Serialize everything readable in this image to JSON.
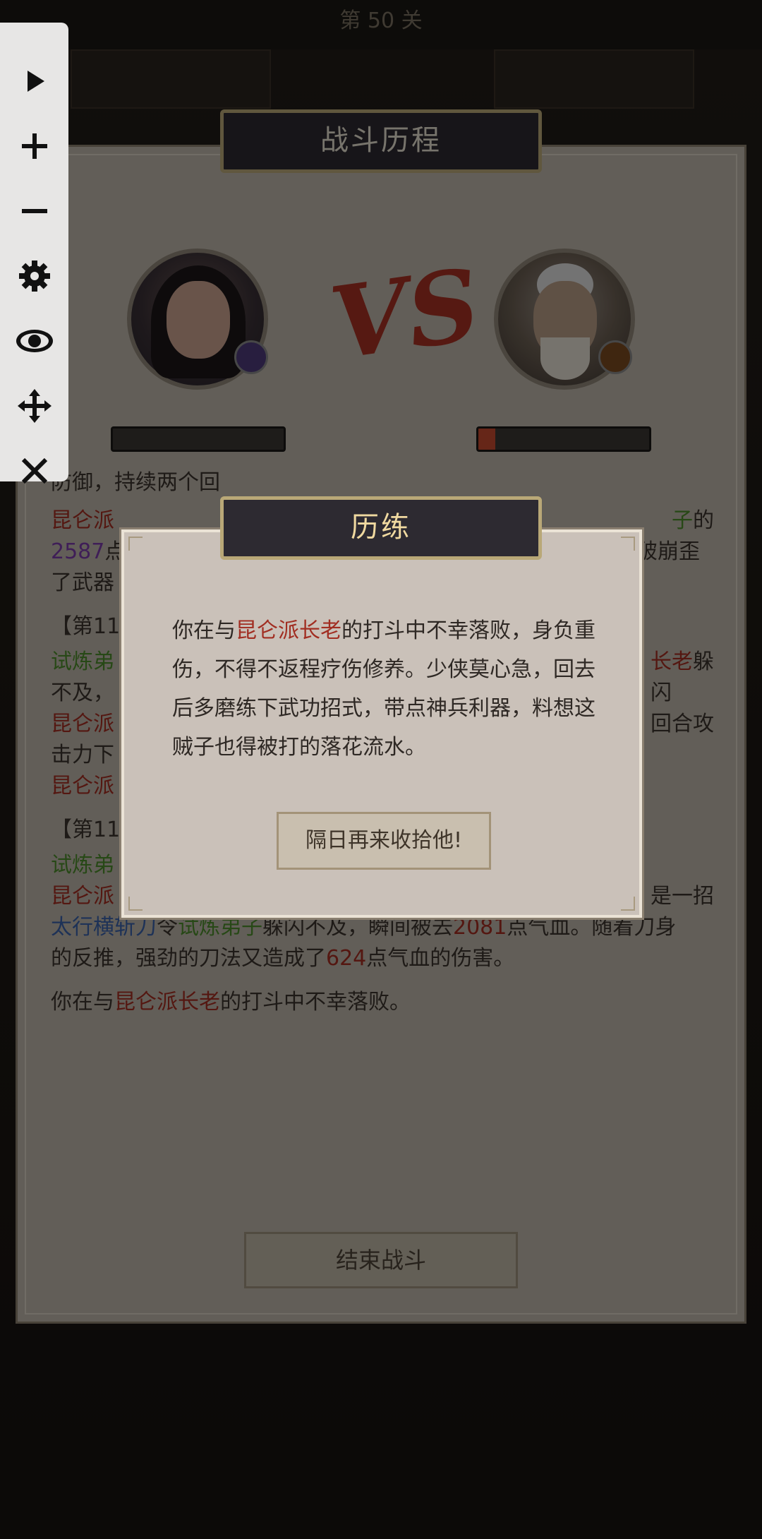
{
  "header": {
    "stage": "第 50 关"
  },
  "battle_panel": {
    "title": "战斗历程"
  },
  "hp_bars": {
    "player_fraction": 0.0,
    "enemy_fraction": 0.1
  },
  "log": {
    "l1_a": "防御，持续两个回",
    "l2_a": "昆仑派",
    "l2_b": "子",
    "l2_c": "的",
    "l3_a": "2587",
    "l3_b": "点",
    "l3_c": "破崩歪",
    "l4_a": "了武器",
    "l5_a": "【第115",
    "l6_a": "试炼弟",
    "l6_b": "长老",
    "l6_c": "躲闪",
    "l7_a": "不及，",
    "l8_a": "昆仑派",
    "l8_b": "回合攻",
    "l9_a": "击力下",
    "l10_a": "昆仑派",
    "l11_a": "【第116",
    "l12_a": "试炼弟",
    "l13_a": "昆仑派",
    "l13_b": "是一招",
    "l14_a": "太行横斩刀",
    "l14_b": "令",
    "l14_c": "试炼弟子",
    "l14_d": "躲闪不及，瞬间被去",
    "l14_e": "2081",
    "l14_f": "点气血。随着刀身",
    "l15_a": "的反推，强劲的刀法又造成了",
    "l15_b": "624",
    "l15_c": "点气血的伤害。",
    "l16_a": "你在与",
    "l16_b": "昆仑派长老",
    "l16_c": "的打斗中不幸落败。"
  },
  "end_button": "结束战斗",
  "dialog": {
    "title": "历练",
    "msg_a": "你在与",
    "msg_b": "昆仑派长老",
    "msg_c": "的打斗中不幸落败，身负重伤，不得不返程疗伤修养。少侠莫心急，回去后多磨练下武功招式，带点神兵利器，料想这贼子也得被打的落花流水。",
    "retry_button": "隔日再来收拾他!"
  },
  "colors": {
    "enemy_name": "#a12d21",
    "player_name": "#4b8a2b",
    "skill": "#3a61a8",
    "number": "#a12d21"
  },
  "toolbar": [
    "play-icon",
    "plus-icon",
    "minus-icon",
    "gear-icon",
    "eye-icon",
    "move-icon",
    "close-icon"
  ]
}
